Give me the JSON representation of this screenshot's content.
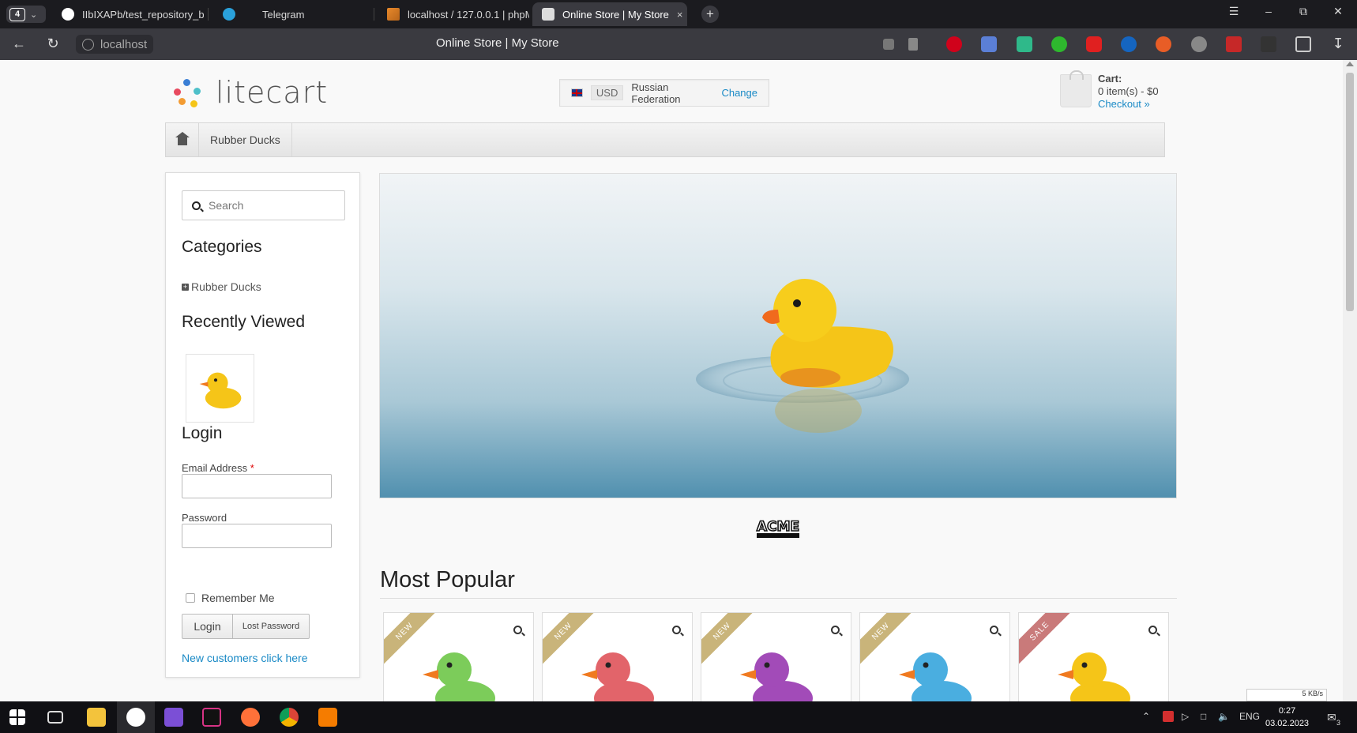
{
  "browser": {
    "tab_count": "4",
    "tabs": [
      {
        "title": "IIbIXAPb/test_repository_b",
        "icon": "github-icon"
      },
      {
        "title": "Telegram",
        "icon": "telegram-icon"
      },
      {
        "title": "localhost / 127.0.0.1 | phpM",
        "icon": "phpmyadmin-icon"
      },
      {
        "title": "Online Store | My Store",
        "icon": "page-icon",
        "active": true
      }
    ],
    "close_label": "×",
    "new_tab_label": "+",
    "url": "localhost",
    "page_title": "Online Store | My Store",
    "colors": {
      "tabstrip": "#1b1b1f",
      "toolbar": "#3a3a40"
    }
  },
  "store": {
    "logo_text": "litecart",
    "region": {
      "currency": "USD",
      "country": "Russian Federation",
      "change_label": "Change"
    },
    "cart": {
      "title": "Cart:",
      "summary": "0 item(s) - $0",
      "checkout_label": "Checkout »"
    },
    "nav": {
      "items": [
        "Rubber Ducks"
      ]
    },
    "sidebar": {
      "search_placeholder": "Search",
      "categories_heading": "Categories",
      "categories": [
        "Rubber Ducks"
      ],
      "recently_viewed_heading": "Recently Viewed",
      "login_heading": "Login",
      "email_label": "Email Address",
      "required_mark": "*",
      "password_label": "Password",
      "remember_label": "Remember Me",
      "login_button": "Login",
      "lost_password_button": "Lost Password",
      "new_customers_link": "New customers click here"
    },
    "most_popular_heading": "Most Popular",
    "products": [
      {
        "badge": "NEW",
        "badge_type": "new",
        "color": "#7ccc5a"
      },
      {
        "badge": "NEW",
        "badge_type": "new",
        "color": "#e2646a"
      },
      {
        "badge": "NEW",
        "badge_type": "new",
        "color": "#a24bb8"
      },
      {
        "badge": "NEW",
        "badge_type": "new",
        "color": "#4aaee0"
      },
      {
        "badge": "SALE",
        "badge_type": "sale",
        "color": "#f5c518"
      }
    ],
    "accent_color": "#1a8ac6"
  },
  "taskbar": {
    "language": "ENG",
    "time": "0:27",
    "date": "03.02.2023",
    "notifications": "3",
    "net_speed": "5 KB/s"
  }
}
